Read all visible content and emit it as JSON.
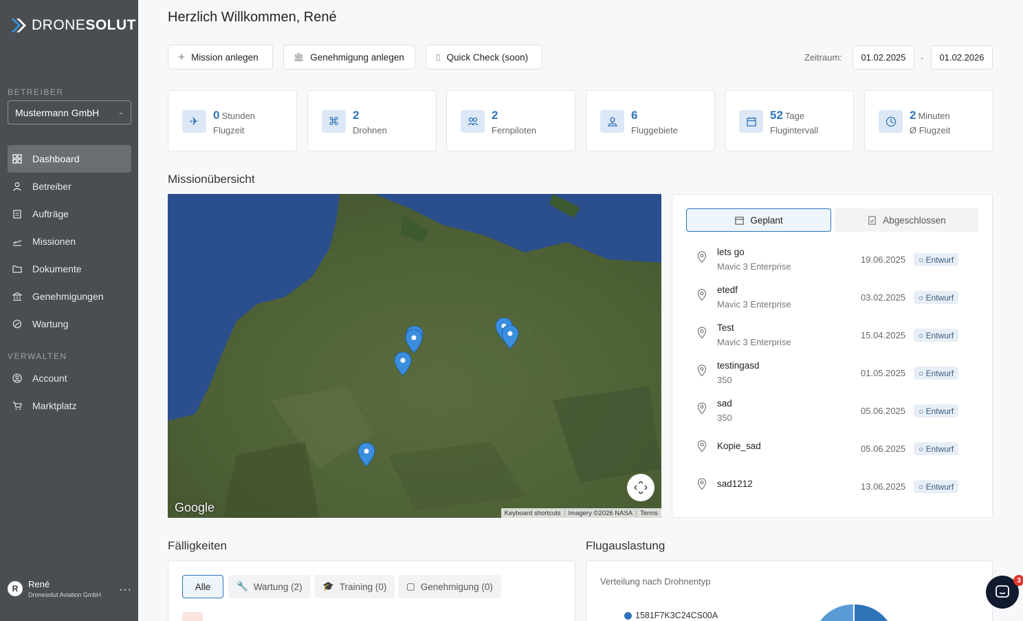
{
  "sidebar": {
    "logo_part1": "DRONE",
    "logo_part2": "SOLUT",
    "section_operator": "BETREIBER",
    "operator_select": "Mustermann GmbH",
    "nav": [
      {
        "label": "Dashboard",
        "icon": "dashboard-icon",
        "active": true
      },
      {
        "label": "Betreiber",
        "icon": "user-icon"
      },
      {
        "label": "Aufträge",
        "icon": "clipboard-icon"
      },
      {
        "label": "Missionen",
        "icon": "plane-icon"
      },
      {
        "label": "Dokumente",
        "icon": "folder-icon"
      },
      {
        "label": "Genehmigungen",
        "icon": "bank-icon"
      },
      {
        "label": "Wartung",
        "icon": "wrench-icon"
      }
    ],
    "section_manage": "VERWALTEN",
    "manage_nav": [
      {
        "label": "Account",
        "icon": "account-icon"
      },
      {
        "label": "Marktplatz",
        "icon": "cart-icon"
      }
    ],
    "user": {
      "initial": "R",
      "name": "René",
      "org": "Dronesolut Aviation GmbH",
      "menu": "···"
    }
  },
  "header": {
    "greeting": "Herzlich Willkommen, René",
    "actions": [
      "Mission anlegen",
      "Genehmigung anlegen",
      "Quick Check (soon)"
    ],
    "zeitraum_label": "Zeitraum:",
    "date_from": "01.02.2025",
    "date_sep": "-",
    "date_to": "01.02.2026"
  },
  "stats": [
    {
      "value": "0",
      "unit": "Stunden",
      "label": "Flugzeit",
      "icon": "plane-icon"
    },
    {
      "value": "2",
      "unit": "",
      "label": "Drohnen",
      "icon": "drone-icon"
    },
    {
      "value": "2",
      "unit": "",
      "label": "Fernpiloten",
      "icon": "pilots-icon"
    },
    {
      "value": "6",
      "unit": "",
      "label": "Fluggebiete",
      "icon": "location-icon"
    },
    {
      "value": "52",
      "unit": "Tage",
      "label": "Flugintervall",
      "icon": "calendar-icon"
    },
    {
      "value": "2",
      "unit": "Minuten",
      "label": "Ø Flugzeit",
      "icon": "clock-icon"
    }
  ],
  "missions_section": {
    "title": "Missionübersicht",
    "map": {
      "logo": "Google",
      "attrib": [
        "Keyboard shortcuts",
        "Imagery ©2026 NASA",
        "Terms"
      ]
    },
    "tabs": {
      "planned": "Geplant",
      "completed": "Abgeschlossen"
    },
    "rows": [
      {
        "name": "lets go",
        "type": "Mavic 3 Enterprise",
        "date": "19.06.2025",
        "status": "○ Entwurf"
      },
      {
        "name": "etedf",
        "type": "Mavic 3 Enterprise",
        "date": "03.02.2025",
        "status": "○ Entwurf"
      },
      {
        "name": "Test",
        "type": "Mavic 3 Enterprise",
        "date": "15.04.2025",
        "status": "○ Entwurf"
      },
      {
        "name": "testingasd",
        "type": "350",
        "date": "01.05.2025",
        "status": "○ Entwurf"
      },
      {
        "name": "sad",
        "type": "350",
        "date": "05.06.2025",
        "status": "○ Entwurf"
      },
      {
        "name": "Kopie_sad",
        "type": "",
        "date": "05.06.2025",
        "status": "○ Entwurf"
      },
      {
        "name": "sad1212",
        "type": "",
        "date": "13.06.2025",
        "status": "○ Entwurf"
      }
    ]
  },
  "due_section": {
    "title": "Fälligkeiten",
    "filters": [
      "Alle",
      "Wartung (2)",
      "Training (0)",
      "Genehmigung (0)"
    ]
  },
  "utilization": {
    "title": "Flugauslastung",
    "subtitle": "Verteilung nach Drohnentyp",
    "legend": "1581F7K3C24CS00A"
  },
  "chat": {
    "badge": "3"
  },
  "colors": {
    "accent": "#2f73b8",
    "sidebar": "#4a4d52"
  }
}
